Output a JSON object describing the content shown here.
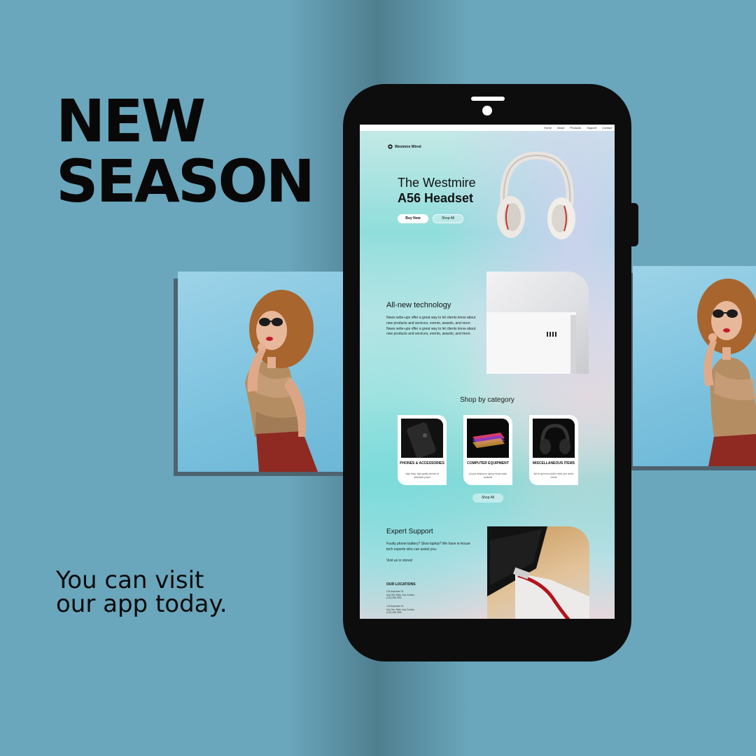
{
  "poster": {
    "headline": [
      "NEW",
      "SEASON"
    ],
    "tagline": [
      "You can visit",
      "our app today."
    ]
  },
  "app": {
    "nav": [
      "Home",
      "About",
      "Products",
      "Support",
      "Contact"
    ],
    "brand": "Westmire Wired",
    "hero": {
      "title_line1": "The Westmire",
      "title_line2": "A56 Headset",
      "buy_label": "Buy Now",
      "shop_label": "Shop All"
    },
    "tech": {
      "title": "All-new technology",
      "body": "News write-ups offer a great way to let clients know about new products and services, events, awards, and more. News write-ups offer a great way to let clients know about new products and services, events, awards, and more."
    },
    "categories": {
      "title": "Shop by category",
      "items": [
        {
          "name": "PHONES & ACCESSORIES",
          "desc": "High class, high quality phones at affordable prices"
        },
        {
          "name": "COMPUTER EQUIPMENT",
          "desc": "All your desktop to laptop needs made available"
        },
        {
          "name": "MISCELLANEOUS ITEMS",
          "desc": "We've got more stuff to meet your techie needs"
        }
      ],
      "shop_all_label": "Shop All"
    },
    "support": {
      "title": "Expert Support",
      "body": "Faulty phone battery? Slow laptop? We have in-house tech experts who can assist you.",
      "visit": "Visit us in stores!",
      "locations_title": "OUR LOCATIONS",
      "locations": [
        {
          "line1": "123 Anywhere St.",
          "line2": "Any City, State, Any Country",
          "line3": "(123) 456-7890"
        },
        {
          "line1": "123 Anywhere St.",
          "line2": "Any City, State, Any Country",
          "line3": "(123) 456-7890"
        }
      ]
    }
  },
  "colors": {
    "background": "#6aa7bd",
    "phone": "#0d0d0d",
    "headline": "#080808"
  }
}
